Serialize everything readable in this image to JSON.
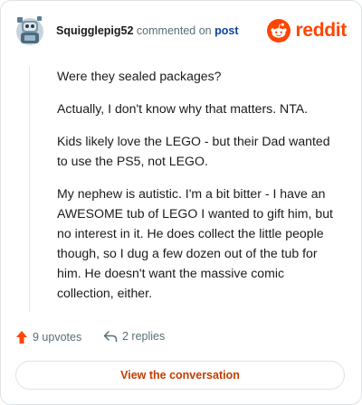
{
  "header": {
    "username": "Squigglepig52",
    "action_text": "commented on",
    "post_link": "post",
    "brand": "reddit",
    "brand_color": "#ff4500",
    "avatar_icon": "snoo-avatar-icon"
  },
  "comment": {
    "paragraphs": [
      "Were they sealed packages?",
      "Actually, I don't know why that matters. NTA.",
      "Kids likely love the LEGO - but their Dad wanted to use the PS5, not LEGO.",
      "My nephew is autistic. I'm a bit bitter - I have an AWESOME tub of LEGO I wanted to gift him, but no interest in it. He does collect the little people though, so I dug a few dozen out of the tub for him. He doesn't want the massive comic collection, either."
    ]
  },
  "footer": {
    "upvotes": "9 upvotes",
    "replies": "2 replies",
    "upvote_color": "#ff4500"
  },
  "cta": {
    "label": "View the conversation",
    "color": "#c83b00"
  }
}
